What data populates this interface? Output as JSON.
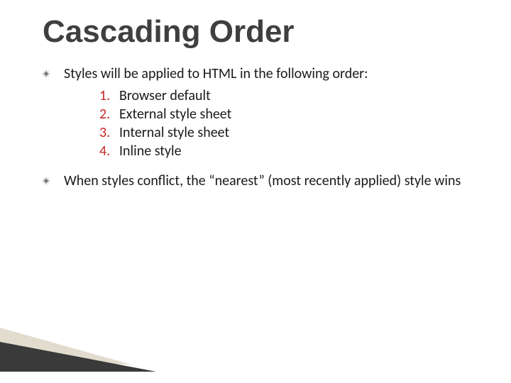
{
  "title": "Cascading Order",
  "bullets": [
    {
      "text": "Styles will be applied to HTML in the following order:",
      "ordered": [
        "Browser default",
        "External style sheet",
        "Internal style sheet",
        "Inline style"
      ]
    },
    {
      "text": "When styles conflict, the “nearest” (most recently applied) style wins",
      "ordered": []
    }
  ],
  "colors": {
    "title": "#3f3f3f",
    "numberAccent": "#c62828",
    "body": "#1a1a1a",
    "wedgeDark": "#3a3a3a",
    "wedgeLight": "#e2dccf"
  }
}
